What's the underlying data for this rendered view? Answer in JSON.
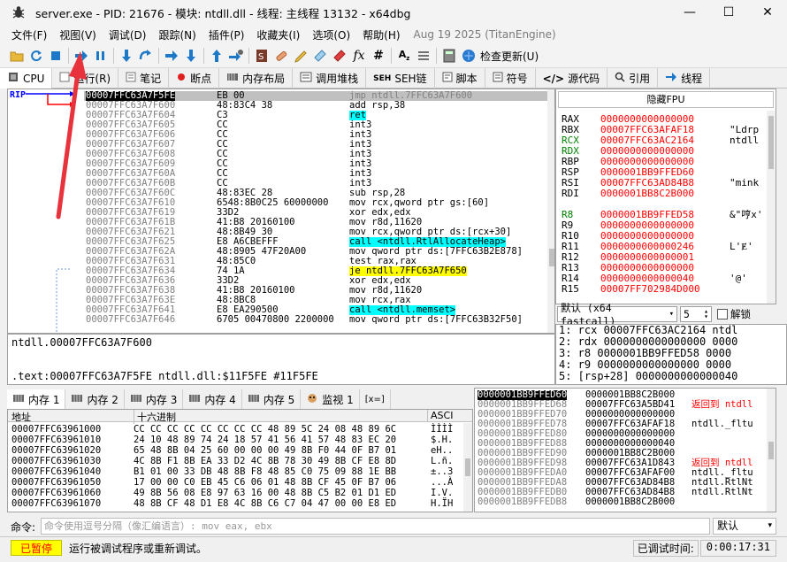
{
  "window": {
    "title": "server.exe - PID: 21676 - 模块: ntdll.dll - 线程: 主线程 13132 - x64dbg",
    "minimize": "—",
    "maximize": "☐",
    "close": "✕"
  },
  "menu": {
    "items": [
      "文件(F)",
      "视图(V)",
      "调试(D)",
      "跟踪(N)",
      "插件(P)",
      "收藏夹(I)",
      "选项(O)",
      "帮助(H)"
    ],
    "date": "Aug 19 2025 (TitanEngine)"
  },
  "toolbar": {
    "update_label": "检查更新(U)"
  },
  "tabs": [
    {
      "icon": "cpu-icon",
      "label": "CPU"
    },
    {
      "icon": "log-icon",
      "label": "运行(R)"
    },
    {
      "icon": "notes-icon",
      "label": "笔记"
    },
    {
      "icon": "breakpoint-icon",
      "label": "断点"
    },
    {
      "icon": "memory-map-icon",
      "label": "内存布局"
    },
    {
      "icon": "callstack-icon",
      "label": "调用堆栈"
    },
    {
      "icon": "seh-icon",
      "label": "SEH链"
    },
    {
      "icon": "script-icon",
      "label": "脚本"
    },
    {
      "icon": "symbols-icon",
      "label": "符号"
    },
    {
      "icon": "source-icon",
      "label": "源代码"
    },
    {
      "icon": "references-icon",
      "label": "引用"
    },
    {
      "icon": "threads-icon",
      "label": "线程"
    }
  ],
  "disasm": {
    "rip_label": "RIP",
    "rows": [
      {
        "addr": "00007FFC63A7F5FE",
        "bytes": "EB 00",
        "inst": "jmp ntdll.7FFC63A7F600",
        "sel": true
      },
      {
        "addr": "00007FFC63A7F600",
        "bytes": "48:83C4 38",
        "inst": "add rsp,38"
      },
      {
        "addr": "00007FFC63A7F604",
        "bytes": "C3",
        "inst": "ret",
        "type": "ret"
      },
      {
        "addr": "00007FFC63A7F605",
        "bytes": "CC",
        "inst": "int3"
      },
      {
        "addr": "00007FFC63A7F606",
        "bytes": "CC",
        "inst": "int3"
      },
      {
        "addr": "00007FFC63A7F607",
        "bytes": "CC",
        "inst": "int3"
      },
      {
        "addr": "00007FFC63A7F608",
        "bytes": "CC",
        "inst": "int3"
      },
      {
        "addr": "00007FFC63A7F609",
        "bytes": "CC",
        "inst": "int3"
      },
      {
        "addr": "00007FFC63A7F60A",
        "bytes": "CC",
        "inst": "int3"
      },
      {
        "addr": "00007FFC63A7F60B",
        "bytes": "CC",
        "inst": "int3"
      },
      {
        "addr": "00007FFC63A7F60C",
        "bytes": "48:83EC 28",
        "inst": "sub rsp,28"
      },
      {
        "addr": "00007FFC63A7F610",
        "bytes": "6548:8B0C25 60000000",
        "inst": "mov rcx,qword ptr gs:[60]",
        "type": "gs"
      },
      {
        "addr": "00007FFC63A7F619",
        "bytes": "33D2",
        "inst": "xor edx,edx"
      },
      {
        "addr": "00007FFC63A7F61B",
        "bytes": "41:B8 20160100",
        "inst": "mov r8d,11620"
      },
      {
        "addr": "00007FFC63A7F621",
        "bytes": "48:8B49 30",
        "inst": "mov rcx,qword ptr ds:[rcx+30]",
        "type": "ds"
      },
      {
        "addr": "00007FFC63A7F625",
        "bytes": "E8 A6CBEFFF",
        "inst": "call <ntdll.RtlAllocateHeap>",
        "type": "call"
      },
      {
        "addr": "00007FFC63A7F62A",
        "bytes": "48:8905 47F20A00",
        "inst": "mov qword ptr ds:[7FFC63B2E878]",
        "type": "ds2"
      },
      {
        "addr": "00007FFC63A7F631",
        "bytes": "48:85C0",
        "inst": "test rax,rax"
      },
      {
        "addr": "00007FFC63A7F634",
        "bytes": "74 1A",
        "inst": "je ntdll.7FFC63A7F650",
        "type": "je"
      },
      {
        "addr": "00007FFC63A7F636",
        "bytes": "33D2",
        "inst": "xor edx,edx"
      },
      {
        "addr": "00007FFC63A7F638",
        "bytes": "41:B8 20160100",
        "inst": "mov r8d,11620"
      },
      {
        "addr": "00007FFC63A7F63E",
        "bytes": "48:8BC8",
        "inst": "mov rcx,rax"
      },
      {
        "addr": "00007FFC63A7F641",
        "bytes": "E8 EA290500",
        "inst": "call <ntdll.memset>",
        "type": "call"
      },
      {
        "addr": "00007FFC63A7F646",
        "bytes": "6705 00470800 2200000",
        "inst": "mov qword ptr ds:[7FFC63B32F50]",
        "type": "ds2"
      }
    ]
  },
  "info": {
    "line1": "ntdll.00007FFC63A7F600",
    "line2": ".text:00007FFC63A7F5FE ntdll.dll:$11F5FE #11F5FE"
  },
  "registers": {
    "hide_fpu": "隐藏FPU",
    "rows": [
      {
        "name": "RAX",
        "value": "0000000000000000",
        "comment": ""
      },
      {
        "name": "RBX",
        "value": "00007FFC63AFAF18",
        "comment": "\"Ldrp"
      },
      {
        "name": "RCX",
        "value": "00007FFC63AC2164",
        "comment": "ntdll",
        "green": true
      },
      {
        "name": "RDX",
        "value": "0000000000000000",
        "comment": "",
        "green": true
      },
      {
        "name": "RBP",
        "value": "0000000000000000",
        "comment": ""
      },
      {
        "name": "RSP",
        "value": "0000001BB9FFED60",
        "comment": ""
      },
      {
        "name": "RSI",
        "value": "00007FFC63AD84B8",
        "comment": "\"mink"
      },
      {
        "name": "RDI",
        "value": "0000001BB8C2B000",
        "comment": ""
      },
      {
        "name": "R8",
        "value": "0000001BB9FFED58",
        "comment": "&\"哼x'",
        "green": true
      },
      {
        "name": "R9",
        "value": "0000000000000000",
        "comment": ""
      },
      {
        "name": "R10",
        "value": "0000000000000000",
        "comment": ""
      },
      {
        "name": "R11",
        "value": "0000000000000246",
        "comment": "L'Ɇ'"
      },
      {
        "name": "R12",
        "value": "0000000000000001",
        "comment": ""
      },
      {
        "name": "R13",
        "value": "0000000000000000",
        "comment": ""
      },
      {
        "name": "R14",
        "value": "0000000000000040",
        "comment": "'@'"
      },
      {
        "name": "R15",
        "value": "00007FF702984D000",
        "comment": ""
      }
    ]
  },
  "callconv": {
    "label": "默认 (x64 fastcall)",
    "count": "5",
    "unlock": "解锁"
  },
  "args": [
    "1: rcx 00007FFC63AC2164 ntdl",
    "2: rdx 0000000000000000 0000",
    "3: r8 0000001BB9FFED58 0000",
    "4: r9 0000000000000000 0000",
    "5: [rsp+28] 0000000000000040"
  ],
  "memtabs": [
    "内存 1",
    "内存 2",
    "内存 3",
    "内存 4",
    "内存 5",
    "监视 1",
    "[x=]"
  ],
  "dump": {
    "col_addr": "地址",
    "col_hex": "十六进制",
    "col_ascii": "ASCI",
    "rows": [
      {
        "addr": "00007FFC63961000",
        "hex": "CC CC CC CC CC CC CC CC 48 89 5C 24 08 48 89 6C",
        "ascii": "ÌÌÌÌ"
      },
      {
        "addr": "00007FFC63961010",
        "hex": "24 10 48 89 74 24 18 57 41 56 41 57 48 83 EC 20",
        "ascii": "$.H."
      },
      {
        "addr": "00007FFC63961020",
        "hex": "65 48 8B 04 25 60 00 00 00 49 8B F0 44 0F B7 01",
        "ascii": "eH.."
      },
      {
        "addr": "00007FFC63961030",
        "hex": "4C 8B F1 8B EA 33 D2 4C 8B 78 30 49 8B CF E8 8D",
        "ascii": "L.ñ."
      },
      {
        "addr": "00007FFC63961040",
        "hex": "B1 01 00 33 DB 48 8B F8 48 85 C0 75 09 88 1E BB",
        "ascii": "±..3"
      },
      {
        "addr": "00007FFC63961050",
        "hex": "17 00 00 C0 EB 45 C6 06 01 48 8B CF 45 0F B7 06",
        "ascii": "...À"
      },
      {
        "addr": "00007FFC63961060",
        "hex": "49 8B 56 08 E8 97 63 16 00 48 8B C5 B2 01 D1 ED",
        "ascii": "I.V."
      },
      {
        "addr": "00007FFC63961070",
        "hex": "48 8B CF 48 D1 E8 4C 8B C6 C7 04 47 00 00 E8 ED",
        "ascii": "H.ÏH"
      }
    ]
  },
  "stack": {
    "rows": [
      {
        "addr": "0000001BB9FFED60",
        "val": "0000001BB8C2B000",
        "cmt": "",
        "sel": true
      },
      {
        "addr": "0000001BB9FFED68",
        "val": "00007FFC63A5BD41",
        "cmt": "返回到 ntdll",
        "red": true
      },
      {
        "addr": "0000001BB9FFED70",
        "val": "0000000000000000",
        "cmt": ""
      },
      {
        "addr": "0000001BB9FFED78",
        "val": "00007FFC63AFAF18",
        "cmt": "ntdll._fltu"
      },
      {
        "addr": "0000001BB9FFED80",
        "val": "0000000000000000",
        "cmt": ""
      },
      {
        "addr": "0000001BB9FFED88",
        "val": "0000000000000040",
        "cmt": ""
      },
      {
        "addr": "0000001BB9FFED90",
        "val": "0000001BB8C2B000",
        "cmt": ""
      },
      {
        "addr": "0000001BB9FFED98",
        "val": "00007FFC63A1D843",
        "cmt": "返回到 ntdll",
        "red": true
      },
      {
        "addr": "0000001BB9FFEDA0",
        "val": "00007FFC63AFAF00",
        "cmt": "ntdll._fltu"
      },
      {
        "addr": "0000001BB9FFEDA8",
        "val": "00007FFC63AD84B8",
        "cmt": "ntdll.RtlNt"
      },
      {
        "addr": "0000001BB9FFEDB0",
        "val": "00007FFC63AD84B8",
        "cmt": "ntdll.RtlNt"
      },
      {
        "addr": "0000001BB9FFEDB8",
        "val": "0000001BB8C2B000",
        "cmt": ""
      }
    ]
  },
  "command": {
    "label": "命令:",
    "placeholder": "命令使用逗号分隔（像汇编语言）: mov eax, ebx",
    "mode": "默认"
  },
  "status": {
    "paused": "已暂停",
    "message": "运行被调试程序或重新调试。",
    "time_label": "已调试时间:",
    "time_value": "0:00:17:31"
  },
  "colors": {
    "register_value": "#ff0000",
    "paused_bg": "#ffff00",
    "call_highlight": "#00ffff",
    "jump_highlight": "#ffff00",
    "annotation_arrow": "#e8323c"
  }
}
